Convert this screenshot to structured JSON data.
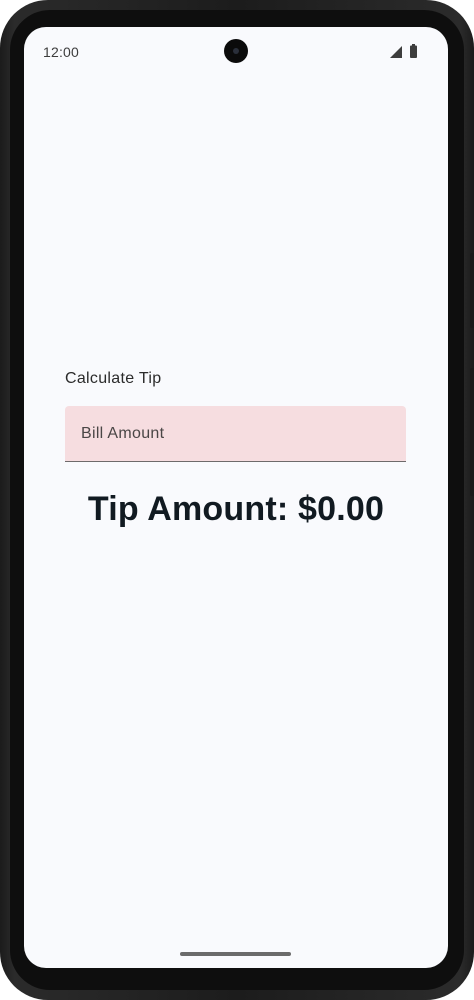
{
  "status_bar": {
    "time": "12:00",
    "signal_icon": "cellular-signal-icon",
    "battery_icon": "battery-full-icon"
  },
  "main": {
    "section_label": "Calculate Tip",
    "bill_field": {
      "value": "",
      "placeholder": "Bill Amount"
    },
    "tip_amount": "Tip Amount: $0.00"
  },
  "colors": {
    "screen_background": "#f9fafd",
    "field_background": "#f6dde0",
    "field_underline": "#6e6a6b",
    "heading_text": "#111a21",
    "device_frame": "#1c1c1c"
  }
}
